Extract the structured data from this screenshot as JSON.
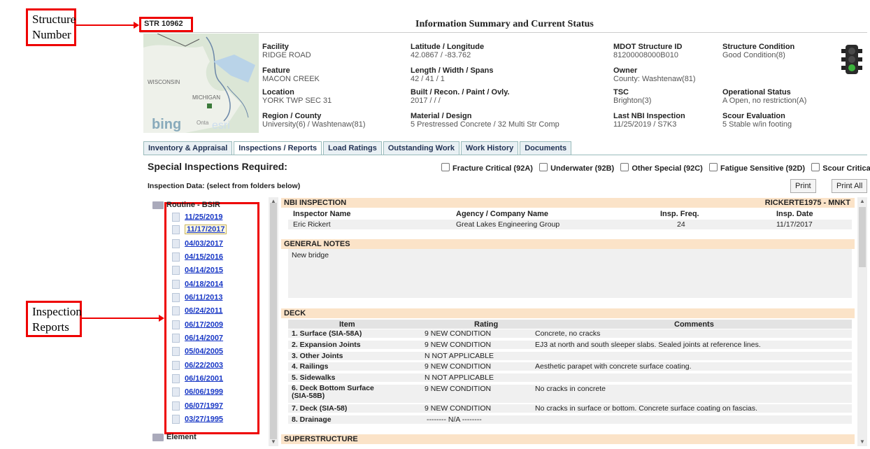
{
  "annotations": {
    "structure_number": "Structure\nNumber",
    "inspection_reports": "Inspection\nReports"
  },
  "header": {
    "structure_number": "STR 10962",
    "title": "Information Summary and Current Status"
  },
  "map": {
    "labels": [
      "WISCONSIN",
      "MICHIGAN",
      "bing",
      "Onta",
      "esri"
    ]
  },
  "summary": [
    {
      "label": "Facility",
      "value": "RIDGE ROAD"
    },
    {
      "label": "Feature",
      "value": "MACON CREEK"
    },
    {
      "label": "Location",
      "value": "YORK TWP SEC 31"
    },
    {
      "label": "Region / County",
      "value": "University(6)  /  Washtenaw(81)"
    },
    {
      "label": "Latitude / Longitude",
      "value": "42.0867  /  -83.762"
    },
    {
      "label": "Length / Width / Spans",
      "value": "42  /  41  /  1"
    },
    {
      "label": "Built / Recon. / Paint / Ovly.",
      "value": "2017  /        /        /"
    },
    {
      "label": "Material / Design",
      "value": "5 Prestressed Concrete  /  32 Multi Str Comp"
    },
    {
      "label": "MDOT Structure ID",
      "value": "81200008000B010"
    },
    {
      "label": "Owner",
      "value": "County: Washtenaw(81)"
    },
    {
      "label": "TSC",
      "value": "Brighton(3)"
    },
    {
      "label": "Last NBI Inspection",
      "value": "11/25/2019  /  S7K3"
    },
    {
      "label": "Structure Condition",
      "value": "Good Condition(8)"
    },
    {
      "label": "Operational Status",
      "value": "A Open, no restriction(A)"
    },
    {
      "label": "Scour Evaluation",
      "value": "5 Stable w/in footing"
    }
  ],
  "status_color": "#3bb33b",
  "tabs": [
    "Inventory & Appraisal",
    "Inspections / Reports",
    "Load Ratings",
    "Outstanding Work",
    "Work History",
    "Documents"
  ],
  "special": {
    "heading": "Special Inspections Required:",
    "options": [
      "Fracture Critical (92A)",
      "Underwater (92B)",
      "Other Special (92C)",
      "Fatigue Sensitive (92D)",
      "Scour Critical"
    ]
  },
  "inspection_data_label": "Inspection Data: (select from folders below)",
  "buttons": {
    "print": "Print",
    "print_all": "Print All"
  },
  "tree": {
    "folder1": "Routine -  BSIR",
    "dates": [
      "11/25/2019",
      "11/17/2017",
      "04/03/2017",
      "04/15/2016",
      "04/14/2015",
      "04/18/2014",
      "06/11/2013",
      "06/24/2011",
      "06/17/2009",
      "06/14/2007",
      "05/04/2005",
      "06/22/2003",
      "06/16/2001",
      "06/06/1999",
      "06/07/1997",
      "03/27/1995"
    ],
    "folder2": "Element"
  },
  "nbi": {
    "title": "NBI INSPECTION",
    "code": "RICKERTE1975 - MNKT",
    "headers": [
      "Inspector Name",
      "Agency / Company Name",
      "Insp. Freq.",
      "Insp. Date"
    ],
    "values": [
      "Eric Rickert",
      "Great Lakes Engineering Group",
      "24",
      "11/17/2017"
    ]
  },
  "general_notes": {
    "title": "GENERAL NOTES",
    "text": "New bridge"
  },
  "deck": {
    "title": "DECK",
    "headers": [
      "Item",
      "Rating",
      "Comments"
    ],
    "rows": [
      {
        "item": "1. Surface (SIA-58A)",
        "rating": "9 NEW CONDITION",
        "comment": "Concrete, no cracks"
      },
      {
        "item": "2. Expansion Joints",
        "rating": "9 NEW CONDITION",
        "comment": "EJ3 at north and south sleeper slabs. Sealed joints at reference lines."
      },
      {
        "item": "3. Other Joints",
        "rating": "N NOT APPLICABLE",
        "comment": ""
      },
      {
        "item": "4. Railings",
        "rating": "9 NEW CONDITION",
        "comment": "Aesthetic parapet with concrete surface coating."
      },
      {
        "item": "5. Sidewalks",
        "rating": "N NOT APPLICABLE",
        "comment": ""
      },
      {
        "item": "6. Deck Bottom Surface\n(SIA-58B)",
        "rating": "9 NEW CONDITION",
        "comment": "No cracks in concrete"
      },
      {
        "item": "7. Deck (SIA-58)",
        "rating": "9 NEW CONDITION",
        "comment": "No cracks in surface or bottom. Concrete surface coating on fascias."
      },
      {
        "item": "8. Drainage",
        "rating": "-------- N/A --------",
        "comment": ""
      }
    ]
  },
  "superstructure": {
    "title": "SUPERSTRUCTURE"
  }
}
